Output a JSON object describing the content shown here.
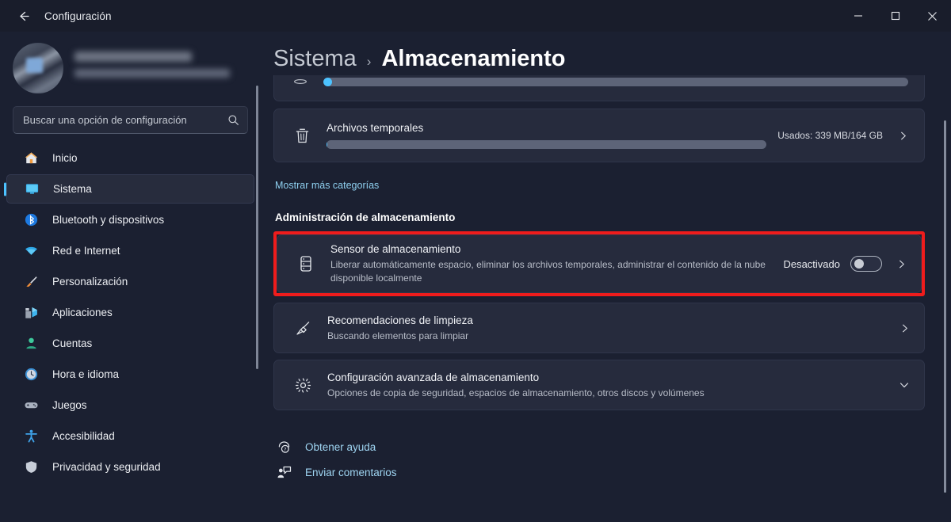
{
  "window": {
    "app_title": "Configuración",
    "back_icon": "arrow-left-icon",
    "minimize_label": "—",
    "maximize_label": "□",
    "close_label": "✕"
  },
  "sidebar": {
    "search": {
      "placeholder": "Buscar una opción de configuración",
      "value": "",
      "icon": "search-icon"
    },
    "items": [
      {
        "label": "Inicio",
        "icon": "home-icon",
        "active": false
      },
      {
        "label": "Sistema",
        "icon": "monitor-icon",
        "active": true
      },
      {
        "label": "Bluetooth y dispositivos",
        "icon": "bluetooth-icon",
        "active": false
      },
      {
        "label": "Red e Internet",
        "icon": "wifi-icon",
        "active": false
      },
      {
        "label": "Personalización",
        "icon": "paintbrush-icon",
        "active": false
      },
      {
        "label": "Aplicaciones",
        "icon": "apps-icon",
        "active": false
      },
      {
        "label": "Cuentas",
        "icon": "person-icon",
        "active": false
      },
      {
        "label": "Hora e idioma",
        "icon": "clock-icon",
        "active": false
      },
      {
        "label": "Juegos",
        "icon": "gamepad-icon",
        "active": false
      },
      {
        "label": "Accesibilidad",
        "icon": "accessibility-icon",
        "active": false
      },
      {
        "label": "Privacidad y seguridad",
        "icon": "shield-icon",
        "active": false
      }
    ]
  },
  "header": {
    "breadcrumb_parent": "Sistema",
    "breadcrumb_separator": "›",
    "breadcrumb_current": "Almacenamiento"
  },
  "main": {
    "temp_files": {
      "title": "Archivos temporales",
      "usage": "Usados: 339 MB/164 GB",
      "icon": "trash-icon",
      "progress_percent": 0.2,
      "chevron": "chevron-right-icon"
    },
    "partial_card": {
      "progress_percent": 1.5
    },
    "show_more_link": "Mostrar más categorías",
    "section_title": "Administración de almacenamiento",
    "storage_sense": {
      "title": "Sensor de almacenamiento",
      "description": "Liberar automáticamente espacio, eliminar los archivos temporales, administrar el contenido de la nube disponible localmente",
      "icon": "storage-drive-icon",
      "toggle_state_label": "Desactivado",
      "toggle_on": false,
      "chevron": "chevron-right-icon",
      "highlight_color": "#ef1c1c"
    },
    "cleanup_recommendations": {
      "title": "Recomendaciones de limpieza",
      "description": "Buscando elementos para limpiar",
      "icon": "broom-icon",
      "chevron": "chevron-right-icon"
    },
    "advanced_storage": {
      "title": "Configuración avanzada de almacenamiento",
      "description": "Opciones de copia de seguridad, espacios de almacenamiento, otros discos y volúmenes",
      "icon": "gear-icon",
      "chevron": "chevron-down-icon"
    },
    "footer": {
      "help_label": "Obtener ayuda",
      "help_icon": "help-icon",
      "feedback_label": "Enviar comentarios",
      "feedback_icon": "feedback-icon"
    }
  },
  "colors": {
    "accent": "#4cc2ff",
    "link": "#8fd0f0",
    "highlight": "#ef1c1c",
    "background": "#1b2031",
    "card": "#262b3d"
  }
}
